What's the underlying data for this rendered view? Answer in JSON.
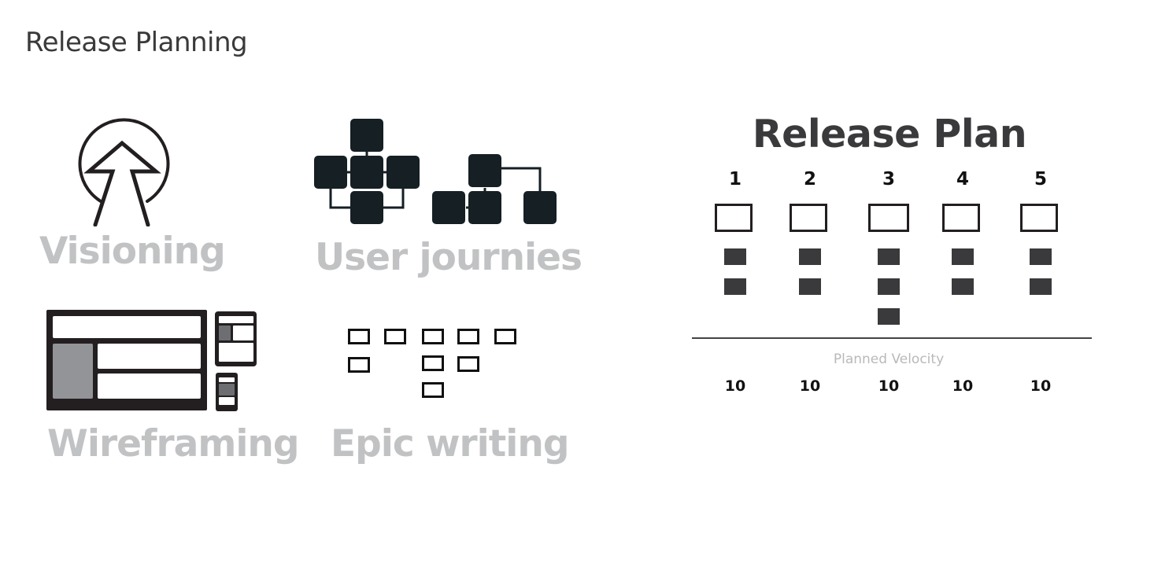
{
  "page": {
    "title": "Release Planning"
  },
  "activities": [
    {
      "label": "Visioning",
      "icon": "vision-arrow-icon"
    },
    {
      "label": "User journies",
      "icon": "user-journey-flow-icon"
    },
    {
      "label": "Wireframing",
      "icon": "wireframe-layouts-icon"
    },
    {
      "label": "Epic writing",
      "icon": "epic-cards-icon"
    }
  ],
  "release_plan": {
    "title": "Release Plan",
    "releases": [
      {
        "number": "1",
        "items": 2,
        "velocity": "10"
      },
      {
        "number": "2",
        "items": 2,
        "velocity": "10"
      },
      {
        "number": "3",
        "items": 3,
        "velocity": "10"
      },
      {
        "number": "4",
        "items": 2,
        "velocity": "10"
      },
      {
        "number": "5",
        "items": 2,
        "velocity": "10"
      }
    ],
    "velocity_label": "Planned Velocity"
  },
  "epic_writing_grid": {
    "columns": [
      2,
      1,
      3,
      2,
      1
    ]
  },
  "colors": {
    "icon_dark": "#151f24",
    "caption_gray": "#c1c2c4",
    "title_text": "#3a3a3c",
    "item_fill": "#3a3a3c"
  }
}
